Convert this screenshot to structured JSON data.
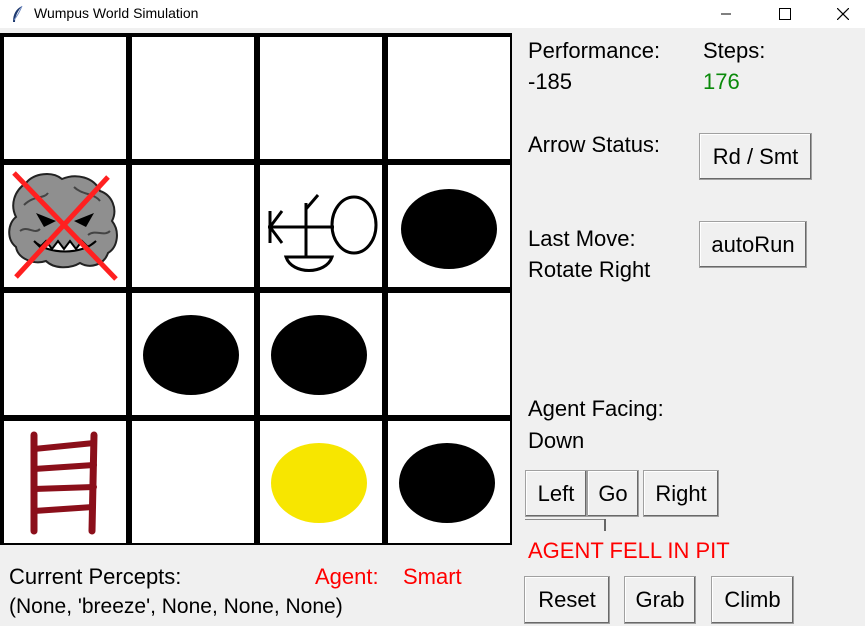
{
  "window": {
    "title": "Wumpus World Simulation",
    "controls": [
      "minimize",
      "maximize",
      "close"
    ]
  },
  "board": {
    "rows": 4,
    "cols": 4,
    "cells": [
      [
        "empty",
        "empty",
        "empty",
        "empty"
      ],
      [
        "dead-wumpus",
        "empty",
        "agent",
        "pit"
      ],
      [
        "empty",
        "pit",
        "pit",
        "empty"
      ],
      [
        "ladder",
        "empty",
        "gold",
        "pit"
      ]
    ]
  },
  "panel": {
    "performance_label": "Performance:",
    "performance_value": "-185",
    "steps_label": "Steps:",
    "steps_value": "176",
    "arrow_label": "Arrow Status:",
    "arrow_button": "Rd / Smt",
    "last_move_label": "Last Move:",
    "last_move_value": "Rotate Right",
    "autorun_button": "autoRun",
    "facing_label": "Agent Facing:",
    "facing_value": "Down",
    "left_button": "Left",
    "go_button": "Go",
    "right_button": "Right",
    "status_message": "AGENT FELL IN PIT",
    "reset_button": "Reset",
    "grab_button": "Grab",
    "climb_button": "Climb"
  },
  "footer": {
    "percepts_label": "Current Percepts:",
    "percepts_value": "(None, 'breeze', None, None, None)",
    "agent_label": "Agent:",
    "agent_value": "Smart"
  },
  "colors": {
    "steps_green": "#0a8a0a",
    "alert_red": "#ff0000",
    "ladder": "#8b0f1a",
    "gold": "#f7e600",
    "pit": "#000000",
    "cross": "#ff2020"
  }
}
